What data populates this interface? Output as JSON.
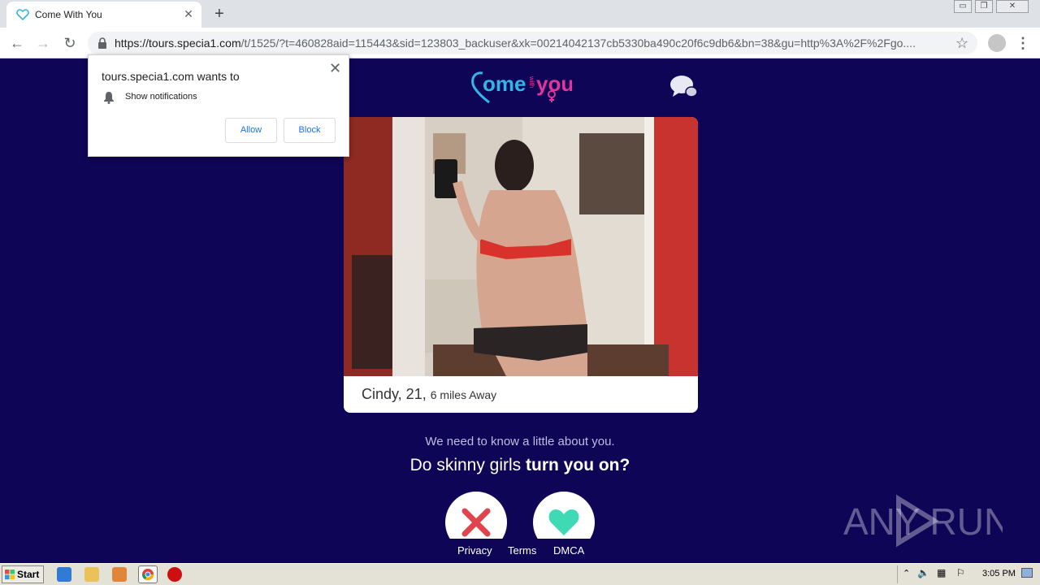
{
  "browser": {
    "tab_title": "Come With You",
    "tab_close": "✕",
    "new_tab": "+",
    "url_host": "https://tours.specia1.com",
    "url_rest": "/t/1525/?t=460828aid=115443&sid=123803_backuser&xk=00214042137cb5330ba490c20f6c9db6&bn=38&gu=http%3A%2F%2Fgo....",
    "window_buttons": [
      "▭",
      "❐",
      "✕"
    ]
  },
  "notification": {
    "site": "tours.specia1.com wants to",
    "permission": "Show notifications",
    "allow": "Allow",
    "block": "Block",
    "close": "✕"
  },
  "page": {
    "logo_main": "ome",
    "logo_small": "with",
    "logo_end": "you",
    "profile_name": "Cindy, 21,",
    "profile_distance": "6 miles Away",
    "intro": "We need to know a little about you.",
    "question_start": "Do skinny girls ",
    "question_strong": "turn you on?",
    "footer": [
      "Privacy",
      "Terms",
      "DMCA"
    ],
    "watermark": "ANY RUN"
  },
  "taskbar": {
    "start": "Start",
    "clock": "3:05 PM"
  },
  "colors": {
    "background": "#0f0557",
    "logo_cyan": "#33b5e5",
    "logo_pink": "#e0359a",
    "no_red": "#e0454f",
    "yes_teal": "#3fd9b5"
  }
}
